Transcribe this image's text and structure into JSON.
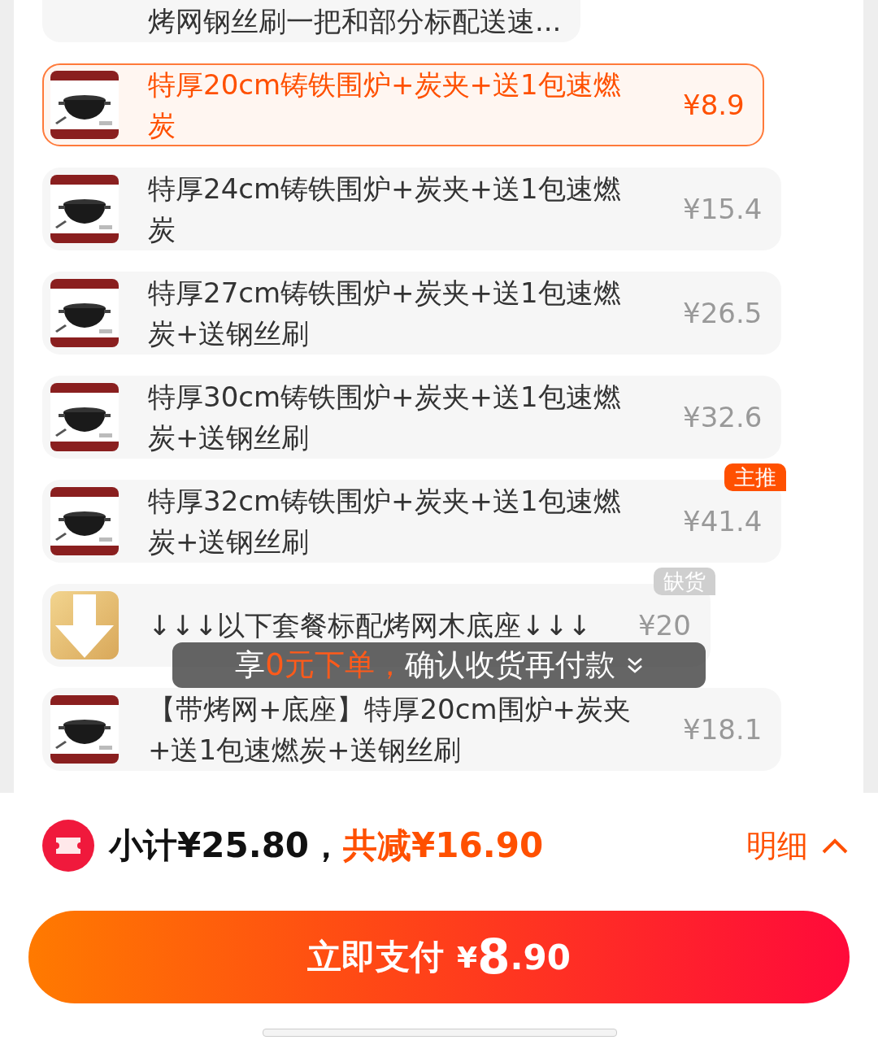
{
  "options": [
    {
      "name": "烤网钢丝刷一把和部分标配送速...",
      "selected": false,
      "kind": "cut"
    },
    {
      "name": "特厚20cm铸铁围炉+炭夹+送1包速燃炭",
      "price": "¥8.9",
      "selected": true,
      "kind": "picture"
    },
    {
      "name": "特厚24cm铸铁围炉+炭夹+送1包速燃炭",
      "price": "¥15.4",
      "selected": false,
      "kind": "picture"
    },
    {
      "name": "特厚27cm铸铁围炉+炭夹+送1包速燃炭+送钢丝刷",
      "price": "¥26.5",
      "selected": false,
      "kind": "picture"
    },
    {
      "name": "特厚30cm铸铁围炉+炭夹+送1包速燃炭+送钢丝刷",
      "price": "¥32.6",
      "selected": false,
      "kind": "picture"
    },
    {
      "name": "特厚32cm铸铁围炉+炭夹+送1包速燃炭+送钢丝刷",
      "price": "¥41.4",
      "selected": false,
      "kind": "picture",
      "badge": {
        "text": "主推",
        "kind": "recommend"
      }
    },
    {
      "name": "↓↓↓以下套餐标配烤网木底座↓↓↓",
      "price": "¥20",
      "selected": false,
      "kind": "arrow",
      "badge": {
        "text": "缺货",
        "kind": "soldout"
      }
    },
    {
      "name": "【带烤网+底座】特厚20cm围炉+炭夹+送1包速燃炭+送钢丝刷",
      "price": "¥18.1",
      "selected": false,
      "kind": "picture"
    }
  ],
  "tip": {
    "lead": "享",
    "highlight": "0元下单，",
    "rest": "确认收货再付款"
  },
  "summary": {
    "subtotal": "小计¥25.80，",
    "discount": "共减¥16.90",
    "detail": "明细"
  },
  "pay": {
    "label": "立即支付",
    "currency": "¥",
    "integer": "8",
    "decimal": ".90"
  }
}
